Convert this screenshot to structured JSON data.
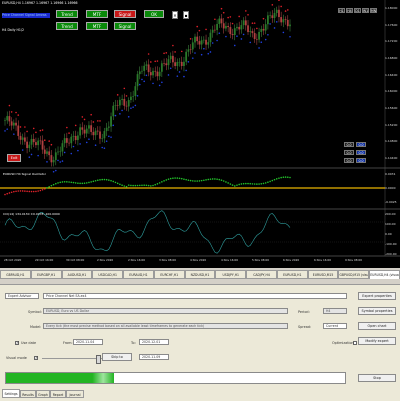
{
  "colors": {
    "bg": "#000000",
    "candle_up": "#2a7a2a",
    "candle_down": "#b04040",
    "dot_red": "#e0202a",
    "dot_blue": "#2040e0",
    "osc_green": "#22c02a",
    "osc_red": "#e0222a",
    "osc_zero": "#e8b400",
    "cci_line": "#2fa0a0",
    "button_green": "#0a8a0a",
    "button_red": "#c81818",
    "progress": "#22b422"
  },
  "chart": {
    "header_line1": "EURUSD,H4 1.16967 1.16967 1.16966 1.16966",
    "header_line2": "Price Channel Signal Arrows",
    "header_line3": "H4 Daily H1/2",
    "buttons": [
      {
        "label": "Trend",
        "style": "green"
      },
      {
        "label": "MTF",
        "style": "green"
      },
      {
        "label": "Signal",
        "style": "red"
      },
      {
        "label": "OK",
        "style": "green"
      },
      {
        "label": "Trend",
        "style": "green"
      },
      {
        "label": "MTF",
        "style": "green"
      },
      {
        "label": "Signal",
        "style": "green"
      }
    ],
    "small_buttons": [
      "✕",
      "▪"
    ],
    "exit_label": "Exit",
    "price_labels": [
      "1.18000",
      "1.17600",
      "1.17200",
      "1.16800",
      "1.16400",
      "1.16000",
      "1.15600",
      "1.15200",
      "1.14800",
      "1.14400"
    ],
    "osc_title": "EURUSD H4 Signal Oscillator",
    "osc_labels": [
      "0.0031",
      "0.0000",
      "-0.0025"
    ],
    "cci_title": "CCI(14) 134.0130 ±0.0078 -100.0000",
    "cci_labels": [
      "200.00",
      "100.00",
      "0.00",
      "-100.00",
      "-200.00"
    ],
    "time_labels": [
      "28 Oct 2020",
      "29 Oct 16:00",
      "30 Oct 08:00",
      "2 Nov 2020",
      "2 Nov 16:00",
      "3 Nov 08:00",
      "4 Nov 2020",
      "4 Nov 16:00",
      "5 Nov 08:00",
      "6 Nov 2020",
      "6 Nov 16:00",
      "9 Nov 08:00"
    ],
    "tf_grid": [
      "H1",
      "H4",
      "D1",
      "W1",
      "MN"
    ],
    "tf_values": [
      "0.0",
      "0.0",
      "0.0",
      "0.0",
      "0.0",
      "0.0"
    ],
    "close_price": [
      1.1675,
      1.1648,
      1.1625,
      1.161,
      1.1595,
      1.162,
      1.166,
      1.164,
      1.1652,
      1.1705,
      1.1725,
      1.1785,
      1.179,
      1.18,
      1.1808,
      1.184,
      1.1855,
      1.189,
      1.188,
      1.1895,
      1.186,
      1.19,
      1.191,
      1.1905
    ]
  },
  "symbol_tabs": [
    "GBPAUD,H1",
    "EURGBP,H1",
    "AUDUSD,H1",
    "USDCAD,H1",
    "EURAUD,H1",
    "EURCHF,H1",
    "NZDUSD,H1",
    "USDJPY,H1",
    "CADJPY,H4",
    "EURUSD,H1",
    "EURUSD,M15",
    "GBPUSD,M15 (visual)",
    "EURUSD,H4 (visual)"
  ],
  "tester": {
    "mode_label": "Expert Advisor",
    "expert_value": "Price Channel Net EA.ex4",
    "symbol_label": "Symbol:",
    "symbol_value": "EURUSD, Euro vs US Dollar",
    "model_label": "Model:",
    "model_value": "Every tick (the most precise method based on all available least timeframes to generate each tick)",
    "use_date_label": "Use date",
    "from_label": "From:",
    "from_value": "2020.11.04",
    "to_label": "To:",
    "to_value": "2020.12.01",
    "visual_label": "Visual mode",
    "skip_label": "Skip to",
    "skip_value": "2020.11.09",
    "period_label": "Period:",
    "period_value": "H4",
    "spread_label": "Spread:",
    "spread_value": "Current",
    "optimization_label": "Optimization",
    "btn_expert_props": "Expert properties",
    "btn_symbol_props": "Symbol properties",
    "btn_open_chart": "Open chart",
    "btn_modify": "Modify expert",
    "btn_stop": "Stop",
    "progress_fraction": 0.32,
    "tabs": [
      "Settings",
      "Results",
      "Graph",
      "Report",
      "Journal"
    ]
  }
}
